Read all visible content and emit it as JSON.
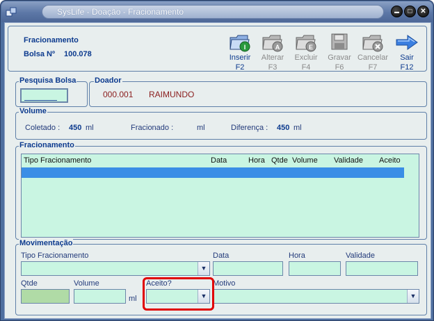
{
  "window": {
    "title": "SysLife - Doação - Fracionamento",
    "buttons": {
      "minimize": "▬",
      "maximize": "□",
      "close": "✕"
    }
  },
  "header": {
    "title": "Fracionamento",
    "bolsa_label": "Bolsa Nº",
    "bolsa_value": "100.078"
  },
  "toolbar": {
    "items": [
      {
        "label": "Inserir",
        "key": "F2",
        "icon": "insert-icon",
        "enabled": true
      },
      {
        "label": "Alterar",
        "key": "F3",
        "icon": "edit-icon",
        "enabled": false
      },
      {
        "label": "Excluir",
        "key": "F4",
        "icon": "delete-icon",
        "enabled": false
      },
      {
        "label": "Gravar",
        "key": "F6",
        "icon": "save-icon",
        "enabled": false
      },
      {
        "label": "Cancelar",
        "key": "F7",
        "icon": "cancel-icon",
        "enabled": false
      },
      {
        "label": "Sair",
        "key": "F12",
        "icon": "exit-arrow-icon",
        "enabled": true
      }
    ]
  },
  "pesquisa": {
    "legend": "Pesquisa Bolsa",
    "value": ""
  },
  "doador": {
    "legend": "Doador",
    "code": "000.001",
    "name": "RAIMUNDO"
  },
  "volume": {
    "legend": "Volume",
    "coletado_label": "Coletado :",
    "coletado_value": "450",
    "fracionado_label": "Fracionado :",
    "fracionado_value": "",
    "diferenca_label": "Diferença :",
    "diferenca_value": "450",
    "unit": "ml"
  },
  "fracionamento": {
    "legend": "Fracionamento",
    "columns": [
      "Tipo Fracionamento",
      "Data",
      "Hora",
      "Qtde",
      "Volume",
      "Validade",
      "Aceito"
    ]
  },
  "movimentacao": {
    "legend": "Movimentação",
    "tipo_label": "Tipo Fracionamento",
    "data_label": "Data",
    "hora_label": "Hora",
    "validade_label": "Validade",
    "qtde_label": "Qtde",
    "volume_label": "Volume",
    "unit": "ml",
    "aceito_label": "Aceito?",
    "motivo_label": "Motivo"
  },
  "colors": {
    "field_bg": "#c9f5e2",
    "selected_row": "#3a8ee6",
    "legend_text": "#0c3a8e",
    "highlight_box": "#e00000"
  }
}
